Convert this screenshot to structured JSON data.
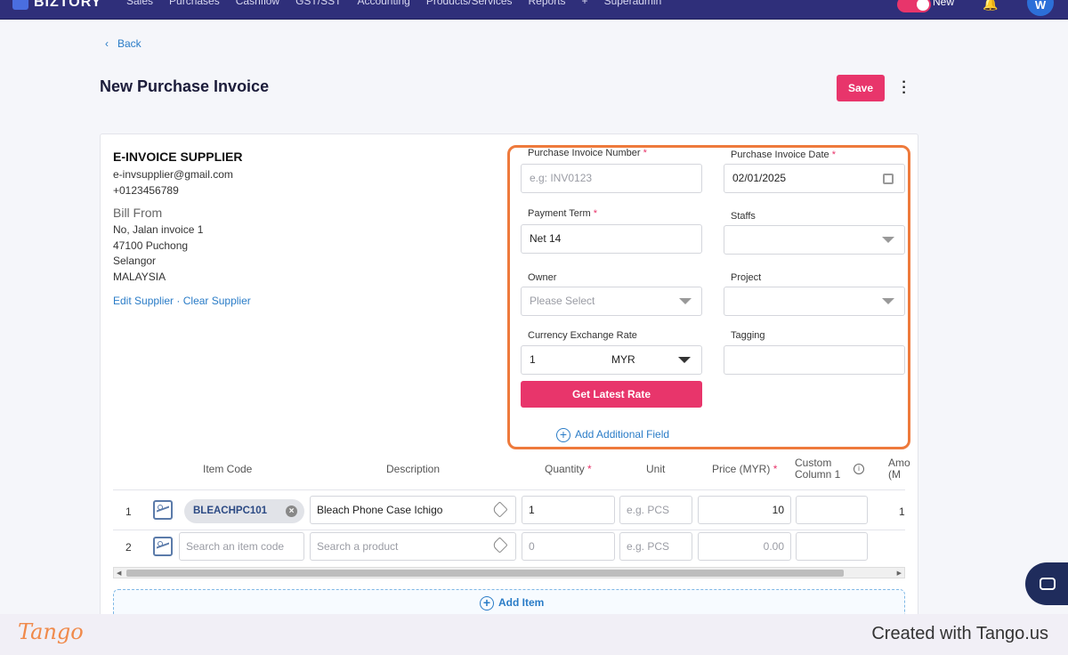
{
  "topbar": {
    "logo": "BIZTORY",
    "nav": [
      "Sales",
      "Purchases",
      "Cashflow",
      "GST/SST",
      "Accounting",
      "Products/Services",
      "Reports",
      "+",
      "Superadmin"
    ],
    "toggle_label": "New",
    "avatar_initial": "W"
  },
  "back_label": "Back",
  "page_title": "New Purchase Invoice",
  "save_label": "Save",
  "supplier": {
    "name": "E-INVOICE SUPPLIER",
    "email": "e-invsupplier@gmail.com",
    "phone": "+0123456789",
    "bill_from_label": "Bill From",
    "address": [
      "No, Jalan invoice 1",
      "47100 Puchong",
      "Selangor",
      "MALAYSIA"
    ],
    "edit_link": "Edit Supplier",
    "separator": "·",
    "clear_link": "Clear Supplier"
  },
  "form": {
    "invoice_number": {
      "label": "Purchase Invoice Number",
      "required": "*",
      "placeholder": "e.g: INV0123"
    },
    "invoice_date": {
      "label": "Purchase Invoice Date",
      "required": "*",
      "value": "02/01/2025"
    },
    "payment_term": {
      "label": "Payment Term",
      "required": "*",
      "value": "Net 14"
    },
    "staffs": {
      "label": "Staffs",
      "value": ""
    },
    "owner": {
      "label": "Owner",
      "placeholder": "Please Select"
    },
    "project": {
      "label": "Project",
      "value": ""
    },
    "currency": {
      "label": "Currency Exchange Rate",
      "rate": "1",
      "currency": "MYR"
    },
    "tagging": {
      "label": "Tagging",
      "value": ""
    },
    "get_rate_label": "Get Latest Rate",
    "add_field_label": "Add Additional Field"
  },
  "table": {
    "headers": {
      "item_code": "Item Code",
      "description": "Description",
      "quantity": "Quantity",
      "unit": "Unit",
      "price": "Price (MYR)",
      "custom_line1": "Custom",
      "custom_line2": "Column 1",
      "amount_line1": "Amo",
      "amount_line2": "(M"
    },
    "required_mark": "*",
    "rows": [
      {
        "num": "1",
        "item_code": "BLEACHPC101",
        "description": "Bleach Phone Case Ichigo",
        "quantity": "1",
        "unit_placeholder": "e.g. PCS",
        "price": "10",
        "custom": "",
        "amount": "1"
      },
      {
        "num": "2",
        "item_code_placeholder": "Search an item code",
        "description_placeholder": "Search a product",
        "quantity_placeholder": "0",
        "unit_placeholder": "e.g. PCS",
        "price_placeholder": "0.00",
        "custom": ""
      }
    ],
    "add_item_label": "Add Item"
  },
  "footer": {
    "tango_logo": "Tango",
    "created_with": "Created with Tango.us"
  }
}
